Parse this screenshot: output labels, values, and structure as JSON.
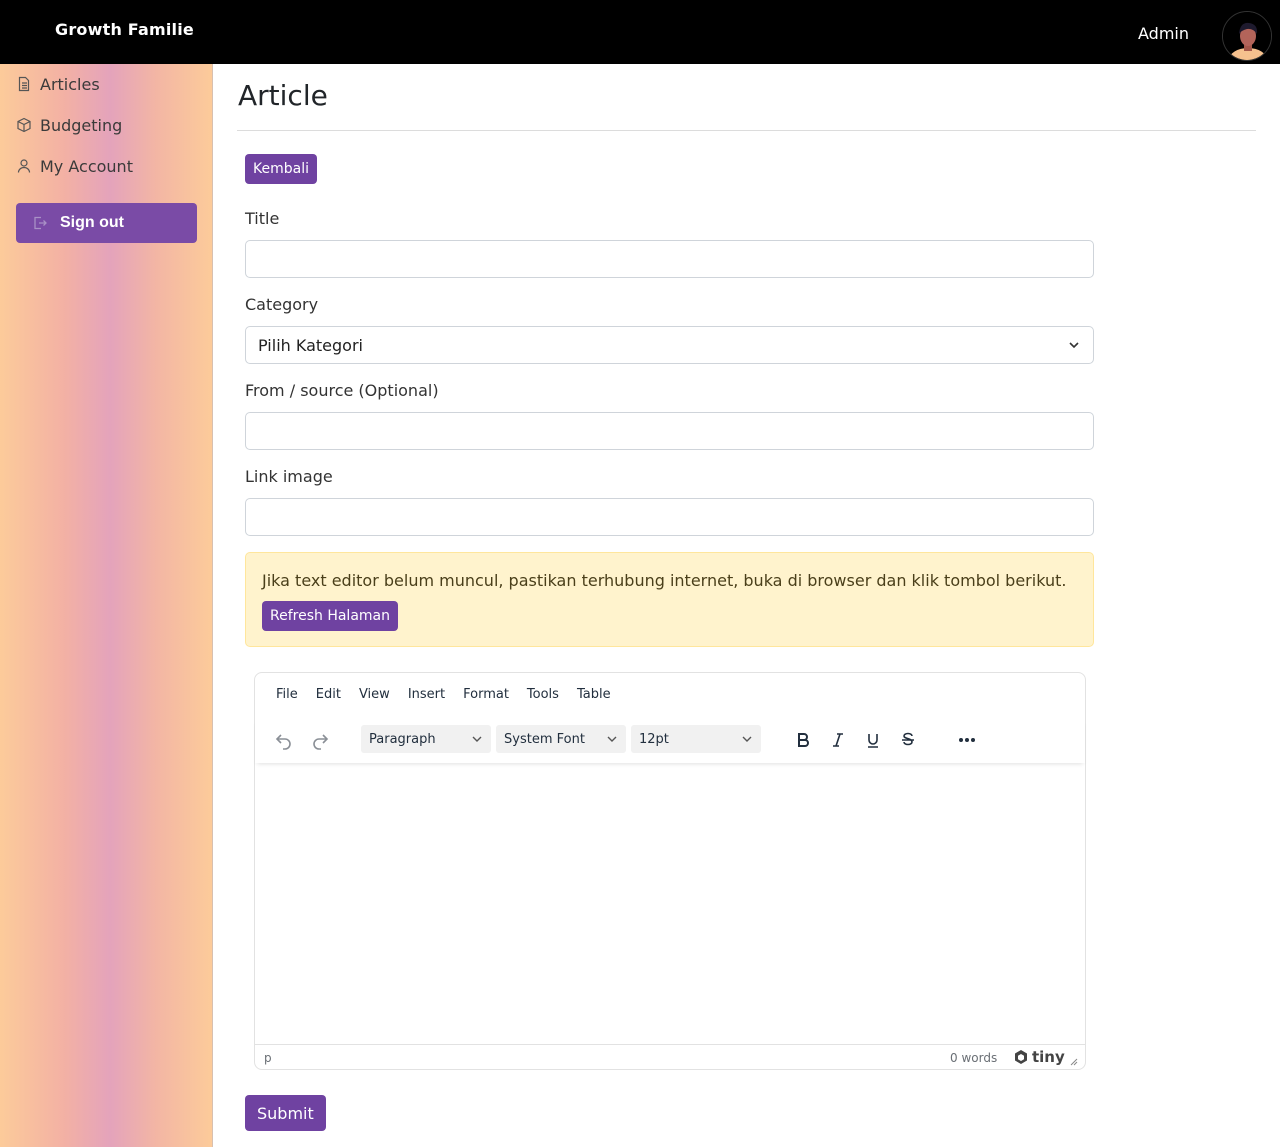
{
  "topbar": {
    "brand": "Growth Familie",
    "user_name": "Admin"
  },
  "sidebar": {
    "items": [
      {
        "label": "Articles",
        "icon": "document-icon"
      },
      {
        "label": "Budgeting",
        "icon": "box-icon"
      },
      {
        "label": "My Account",
        "icon": "user-icon"
      }
    ],
    "signout_label": "Sign out"
  },
  "main": {
    "title": "Article",
    "back_label": "Kembali",
    "form": {
      "title_label": "Title",
      "title_value": "",
      "category_label": "Category",
      "category_value": "Pilih Kategori",
      "source_label": "From / source (Optional)",
      "source_value": "",
      "image_label": "Link image",
      "image_value": ""
    },
    "alert": {
      "text": "Jika text editor belum muncul, pastikan terhubung internet, buka di browser dan klik tombol berikut.",
      "button_label": "Refresh Halaman"
    },
    "editor": {
      "menu": [
        "File",
        "Edit",
        "View",
        "Insert",
        "Format",
        "Tools",
        "Table"
      ],
      "block_format": "Paragraph",
      "font_family": "System Font",
      "font_size": "12pt",
      "status_path": "p",
      "word_count": "0 words",
      "brand": "tiny"
    },
    "submit_label": "Submit"
  },
  "colors": {
    "accent": "#6f42a1",
    "topbar": "#000000",
    "alert_bg": "#fff3cd"
  }
}
